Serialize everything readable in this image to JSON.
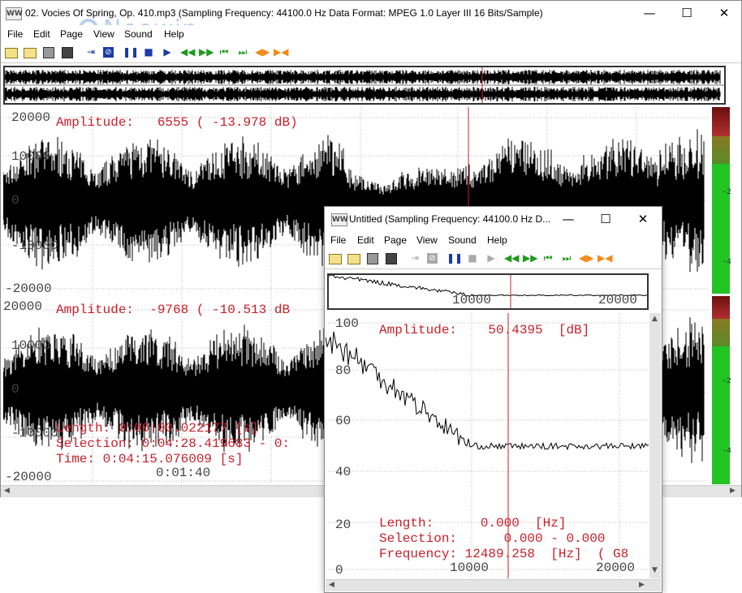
{
  "main_window": {
    "app_icon_text": "WW",
    "title": "02. Vocies Of Spring, Op. 410.mp3  (Sampling Frequency: 44100.0 Hz  Data Format: MPEG 1.0 Layer III  16 Bits/Sample)",
    "menu": [
      "File",
      "Edit",
      "Page",
      "View",
      "Sound",
      "Help"
    ],
    "watermark": "Neowin",
    "channel1": {
      "readout": "Amplitude:   6555 ( -13.978 dB)",
      "y_labels": [
        "20000",
        "10000",
        "0",
        "-10000",
        "-20000"
      ]
    },
    "channel2": {
      "readout": "Amplitude:  -9768 ( -10.513 dB",
      "y_labels": [
        "20000",
        "10000",
        "0",
        "-10000",
        "-20000"
      ],
      "length": "Length: 0:00:00.022177 [s]",
      "selection": "Selection: 0:04:28.419683 - 0:",
      "time": "Time: 0:04:15.076009 [s]",
      "x_label": "0:01:40"
    },
    "vu_labels": [
      "-2",
      "-4",
      "-2",
      "-4"
    ]
  },
  "spectrum_window": {
    "app_icon_text": "WW",
    "title": "Untitled  (Sampling Frequency: 44100.0 Hz  D...",
    "menu": [
      "File",
      "Edit",
      "Page",
      "View",
      "Sound",
      "Help"
    ],
    "overview_x_labels": [
      "10000",
      "20000"
    ],
    "readout": "Amplitude:    50.4395  [dB]",
    "y_labels": [
      "100",
      "80",
      "60",
      "40",
      "20",
      "0"
    ],
    "x_labels": [
      "10000",
      "20000"
    ],
    "length": "Length:      0.000  [Hz]",
    "selection": "Selection:      0.000 - 0.000",
    "frequency": "Frequency: 12489.258  [Hz]  ( G8"
  },
  "colors": {
    "cursor": "#c8202a",
    "readout": "#c8202a",
    "vu_red": "#8b1a1a",
    "vu_green": "#22c422"
  }
}
